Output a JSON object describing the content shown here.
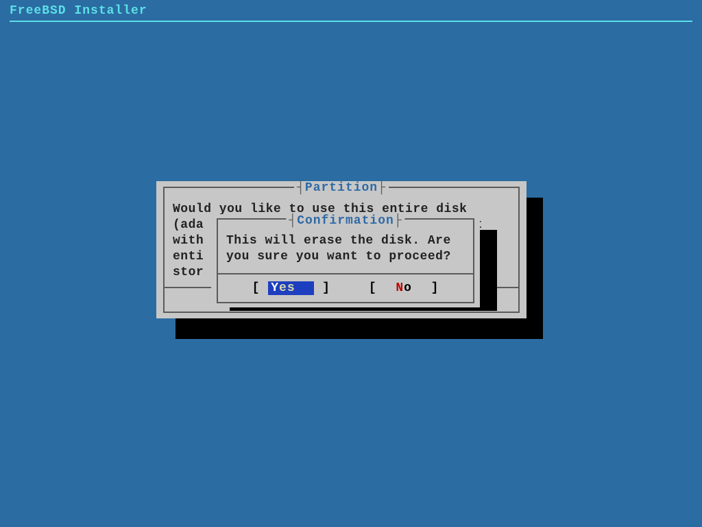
{
  "header": {
    "title": "FreeBSD Installer"
  },
  "partition_dialog": {
    "title": "Partition",
    "text": "Would you like to use this entire disk\n(ada                                  it\nwith                                   \nenti                                  ly\nstor"
  },
  "confirmation_dialog": {
    "title": "Confirmation",
    "text": "This will erase the disk. Are\nyou sure you want to proceed?",
    "yes": {
      "hotkey": "Y",
      "rest": "es",
      "bracket_open": "[",
      "bracket_close": "]"
    },
    "no": {
      "hotkey": "N",
      "rest": "o",
      "bracket_open": "[",
      "bracket_close": "]"
    }
  }
}
